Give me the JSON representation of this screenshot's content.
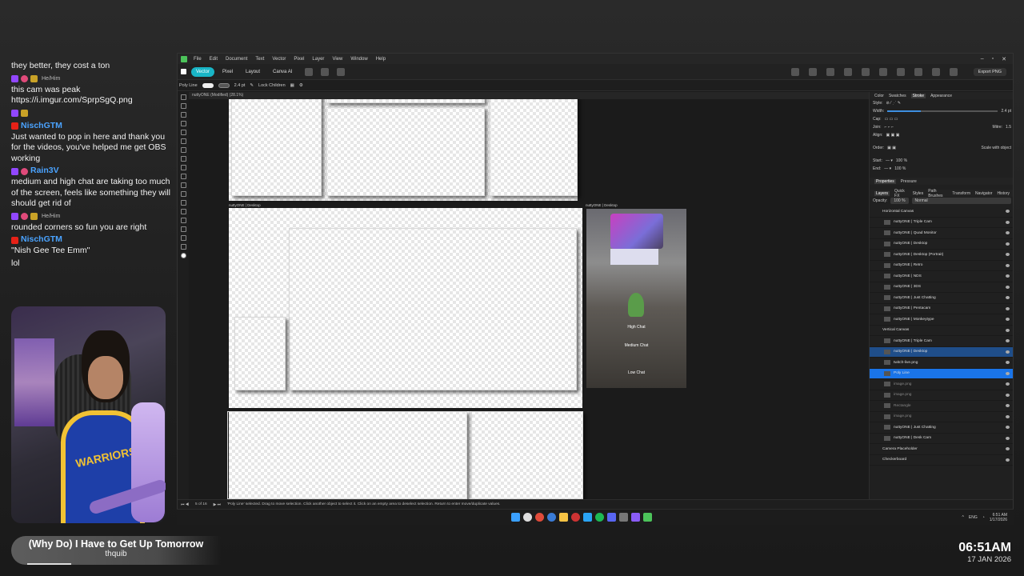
{
  "chat": [
    {
      "user": "",
      "msg": "they better, they cost a ton",
      "badges": [],
      "platform": ""
    },
    {
      "user": "",
      "pronoun": "He/Him",
      "msg": "this cam was peak https://i.imgur.com/SprpSgQ.png",
      "badges": [
        "twitch",
        "heart",
        "gift"
      ],
      "user_color": "#a020f0"
    },
    {
      "user": "",
      "msg": "",
      "badges": [
        "twitch",
        "gift"
      ],
      "user_color": "#b22222"
    },
    {
      "user": "NischGTM",
      "msg": "Just wanted to pop in here and thank you for the videos, you've helped me get OBS working",
      "badges": [
        "youtube"
      ],
      "user_color": "#4aa3ff"
    },
    {
      "user": "Rain3V",
      "msg": "medium and high chat are taking too much of the screen, feels like something they will should get rid of",
      "badges": [
        "twitch",
        "heart"
      ],
      "user_color": "#4aa3ff"
    },
    {
      "user": "",
      "pronoun": "He/Him",
      "msg": "rounded corners so fun you are right",
      "badges": [
        "twitch",
        "heart",
        "gift"
      ],
      "user_color": "#c030c0"
    },
    {
      "user": "NischGTM",
      "msg": "\"Nish Gee Tee Emm\"",
      "badges": [
        "youtube"
      ],
      "user_color": "#4aa3ff"
    },
    {
      "user": "",
      "msg": "lol",
      "badges": [],
      "platform": ""
    }
  ],
  "webcam": {
    "jersey_text": "WARRIORS"
  },
  "now_playing": {
    "song": "(Why Do) I Have to Get Up Tomorrow",
    "artist": "thquib",
    "progress": 0.21
  },
  "clock": {
    "time": "06:51AM",
    "date": "17 JAN 2026"
  },
  "app": {
    "menus": [
      "File",
      "Edit",
      "Document",
      "Text",
      "Vector",
      "Pixel",
      "Layer",
      "View",
      "Window",
      "Help"
    ],
    "personas": [
      {
        "label": "Vector",
        "active": true
      },
      {
        "label": "Pixel",
        "active": false
      },
      {
        "label": "Layout",
        "active": false
      },
      {
        "label": "Canva AI",
        "active": false
      }
    ],
    "export_label": "Export PNG",
    "context": {
      "tool": "Poly Line",
      "stroke": "2.4 pt",
      "lock_children": "Lock Children"
    },
    "doc_title": "nuttyONE (Modified) (28.1%)",
    "artboard_labels": {
      "desktop": "nuttyONE | Desktop",
      "vertical": "nuttyONE | Desktop",
      "bottom": "nuttyONE | Desktop Portrait"
    },
    "vertical_labels": {
      "high": "High Chat",
      "medium": "Medium Chat",
      "low": "Low Chat"
    },
    "page_indicator": "5 of 16",
    "status_text": "'Poly Line' selected. Drag to move selection. Click another object to select it. Click on an empty area to deselect selection. Return to enter move/duplicate values.",
    "right_tabs": [
      "Color",
      "Swatches",
      "Stroke",
      "Appearance"
    ],
    "stroke": {
      "style": "Style:",
      "width_label": "Width:",
      "width_value": "2.4 pt",
      "cap": "Cap:",
      "join": "Join:",
      "mitre_label": "Mitre:",
      "mitre_value": "1.5",
      "align": "Align:",
      "order": "Order:",
      "scale_with_object": "Scale with object",
      "start": "Start:",
      "end": "End:",
      "start_pct": "100 %",
      "end_pct": "100 %"
    },
    "props_tabs": [
      "Properties",
      "Pressure"
    ],
    "layer_tabs": [
      "Layers",
      "Quick FX",
      "Styles",
      "Path Brushes",
      "Transform",
      "Navigator",
      "History"
    ],
    "opacity": {
      "label": "Opacity:",
      "value": "100 %",
      "blend": "Normal"
    },
    "layers": [
      {
        "name": "Horizontal Canvas",
        "type": "group"
      },
      {
        "name": "nuttyONE | Triple Cam",
        "type": "item"
      },
      {
        "name": "nuttyONE | Quad Monitor",
        "type": "item"
      },
      {
        "name": "nuttyONE | Desktop",
        "type": "item"
      },
      {
        "name": "nuttyONE | Desktop (Portrait)",
        "type": "item"
      },
      {
        "name": "nuttyONE | Retro",
        "type": "item"
      },
      {
        "name": "nuttyONE | NDS",
        "type": "item"
      },
      {
        "name": "nuttyONE | 3DS",
        "type": "item"
      },
      {
        "name": "nuttyONE | Just Chatting",
        "type": "item"
      },
      {
        "name": "nuttyONE | Pentacam",
        "type": "item"
      },
      {
        "name": "nuttyONE | Monkeytype",
        "type": "item"
      },
      {
        "name": "Vertical Canvas",
        "type": "group"
      },
      {
        "name": "nuttyONE | Triple Cam",
        "type": "item"
      },
      {
        "name": "nuttyONE | Desktop",
        "type": "sel1"
      },
      {
        "name": "twitch-live.png",
        "type": "item"
      },
      {
        "name": "Poly Line",
        "type": "sel2"
      },
      {
        "name": "image.png",
        "type": "dim"
      },
      {
        "name": "image.png",
        "type": "dim"
      },
      {
        "name": "Rectangle",
        "type": "dim"
      },
      {
        "name": "image.png",
        "type": "dim"
      },
      {
        "name": "nuttyONE | Just Chatting",
        "type": "item"
      },
      {
        "name": "nuttyONE | Desk Cam",
        "type": "item"
      },
      {
        "name": "Camera Placeholder",
        "type": "group"
      },
      {
        "name": "Checkerboard",
        "type": "group"
      }
    ]
  },
  "taskbar": {
    "lang": "ENG",
    "time": "6:51 AM",
    "date": "1/17/2026"
  }
}
